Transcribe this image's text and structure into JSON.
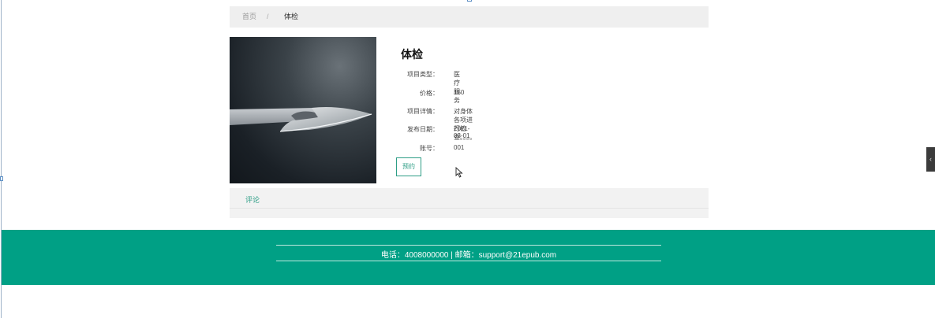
{
  "breadcrumb": {
    "home": "首页",
    "separator": "/",
    "current": "体检"
  },
  "product": {
    "image_icon": "scalpel-image",
    "title": "体检",
    "fields": [
      {
        "label": "项目类型：",
        "value": "医疗服务"
      },
      {
        "label": "价格：",
        "value": "150"
      },
      {
        "label": "项目详情：",
        "value": "对身体各项进行检查。。。。"
      },
      {
        "label": "发布日期：",
        "value": "2021-03-01"
      },
      {
        "label": "账号：",
        "value": "001"
      }
    ],
    "book_label": "预约"
  },
  "comments": {
    "tab_label": "评论"
  },
  "side_toggle": {
    "icon": "chevron-left-icon",
    "glyph": "‹"
  },
  "footer": {
    "contact": "电话：4008000000 | 邮箱：support@21epub.com",
    "background": "#00a085"
  },
  "colors": {
    "accent": "#2e9e86",
    "breadcrumb_bg": "#efefef"
  }
}
